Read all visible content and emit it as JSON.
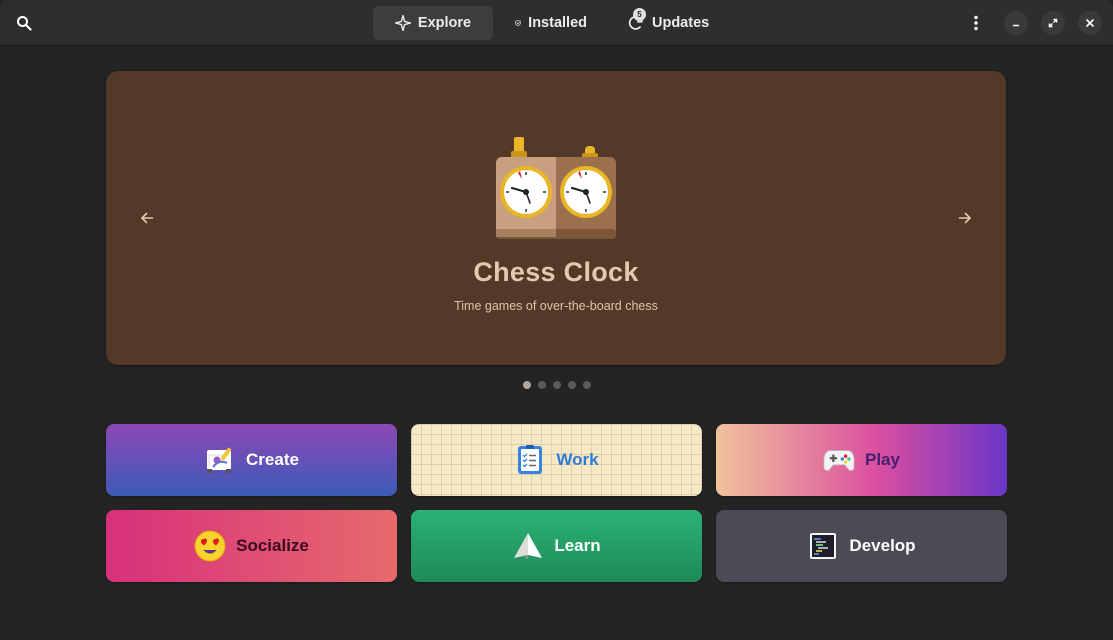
{
  "header": {
    "tabs": [
      {
        "label": "Explore",
        "icon": "explore-icon",
        "active": true
      },
      {
        "label": "Installed",
        "icon": "installed-icon",
        "active": false
      },
      {
        "label": "Updates",
        "icon": "updates-icon",
        "active": false,
        "badge": "5"
      }
    ],
    "icons": {
      "search": "search-icon",
      "menu": "menu-icon",
      "minimize": "minimize-icon",
      "maximize": "maximize-icon",
      "close": "close-icon"
    }
  },
  "carousel": {
    "app_name": "Chess Clock",
    "app_description": "Time games of over-the-board chess",
    "background_color": "#533a28",
    "dot_count": 5,
    "active_dot": 1
  },
  "categories": [
    {
      "label": "Create",
      "icon": "create-icon"
    },
    {
      "label": "Work",
      "icon": "work-icon"
    },
    {
      "label": "Play",
      "icon": "play-icon"
    },
    {
      "label": "Socialize",
      "icon": "socialize-icon"
    },
    {
      "label": "Learn",
      "icon": "learn-icon"
    },
    {
      "label": "Develop",
      "icon": "develop-icon"
    }
  ],
  "colors": {
    "window_bg": "#242424",
    "headerbar_bg": "#2e2e2e",
    "work_text": "#2e7bd6"
  }
}
